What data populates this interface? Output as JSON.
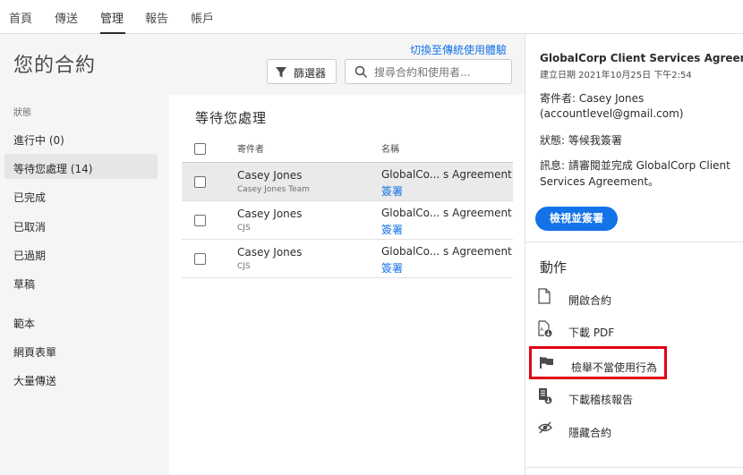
{
  "topnav": {
    "tabs": [
      {
        "label": "首頁"
      },
      {
        "label": "傳送"
      },
      {
        "label": "管理"
      },
      {
        "label": "報告"
      },
      {
        "label": "帳戶"
      }
    ]
  },
  "header": {
    "switch_link": "切換至傳統使用體驗",
    "title": "您的合約",
    "filter_label": "篩選器",
    "search_placeholder": "搜尋合約和使用者..."
  },
  "sidebar": {
    "status_label": "狀態",
    "items": [
      {
        "label": "進行中 (0)"
      },
      {
        "label": "等待您處理 (14)"
      },
      {
        "label": "已完成"
      },
      {
        "label": "已取消"
      },
      {
        "label": "已過期"
      },
      {
        "label": "草稿"
      },
      {
        "label": "範本"
      },
      {
        "label": "網頁表單"
      },
      {
        "label": "大量傳送"
      }
    ]
  },
  "main": {
    "title": "等待您處理",
    "col_sender": "寄件者",
    "col_name": "名稱",
    "rows": [
      {
        "sender": "Casey Jones",
        "sender_sub": "Casey Jones Team",
        "name": "GlobalCo... s Agreement",
        "action": "簽署"
      },
      {
        "sender": "Casey Jones",
        "sender_sub": "CJS",
        "name": "GlobalCo... s Agreement",
        "action": "簽署"
      },
      {
        "sender": "Casey Jones",
        "sender_sub": "CJS",
        "name": "GlobalCo... s Agreement",
        "action": "簽署"
      }
    ]
  },
  "detail": {
    "title": "GlobalCorp Client Services Agreement",
    "date": "建立日期 2021年10月25日 下午2:54",
    "sender_line1": "寄件者: Casey Jones",
    "sender_line2": "(accountlevel@gmail.com)",
    "status": "狀態: 等候我簽署",
    "message_line1": "訊息: 請審閱並完成 GlobalCorp Client",
    "message_line2": "Services Agreement。",
    "view_button": "檢視並簽署",
    "actions_title": "動作",
    "actions": [
      {
        "label": "開啟合約",
        "icon": "document-icon"
      },
      {
        "label": "下載 PDF",
        "icon": "download-pdf-icon"
      },
      {
        "label": "檢舉不當使用行為",
        "icon": "flag-icon"
      },
      {
        "label": "下載稽核報告",
        "icon": "audit-report-icon"
      },
      {
        "label": "隱藏合約",
        "icon": "hide-eye-icon"
      }
    ]
  },
  "colors": {
    "accent": "#1473e6",
    "highlight_box": "#e00012"
  }
}
